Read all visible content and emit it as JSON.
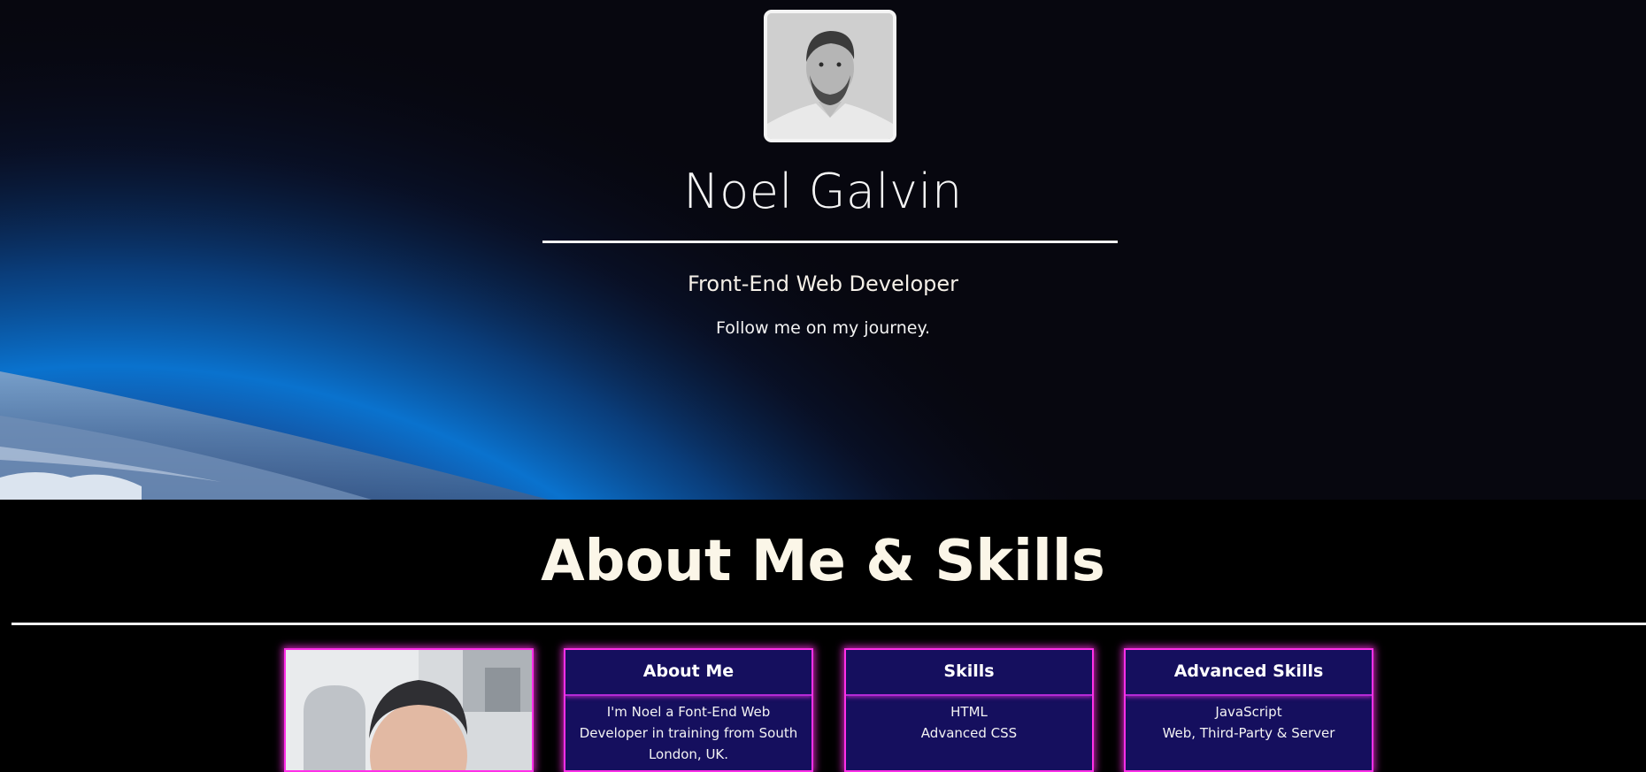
{
  "hero": {
    "name": "Noel Galvin",
    "role": "Front-End Web Developer",
    "tagline": "Follow me on my journey.",
    "avatar_icon": "portrait-photo"
  },
  "about": {
    "title": "About Me & Skills",
    "photo_icon": "profile-photo",
    "cards": [
      {
        "title": "About Me",
        "text": "I'm Noel a Font-End Web Developer in training from South London, UK."
      },
      {
        "title": "Skills",
        "items": [
          "HTML",
          "Advanced CSS"
        ]
      },
      {
        "title": "Advanced Skills",
        "items": [
          "JavaScript",
          "Web, Third-Party & Server"
        ]
      }
    ]
  },
  "colors": {
    "card_border": "#ff2fe8",
    "card_background": "#150f5e",
    "page_background": "#000000",
    "accent_blue": "#0a74d6"
  }
}
